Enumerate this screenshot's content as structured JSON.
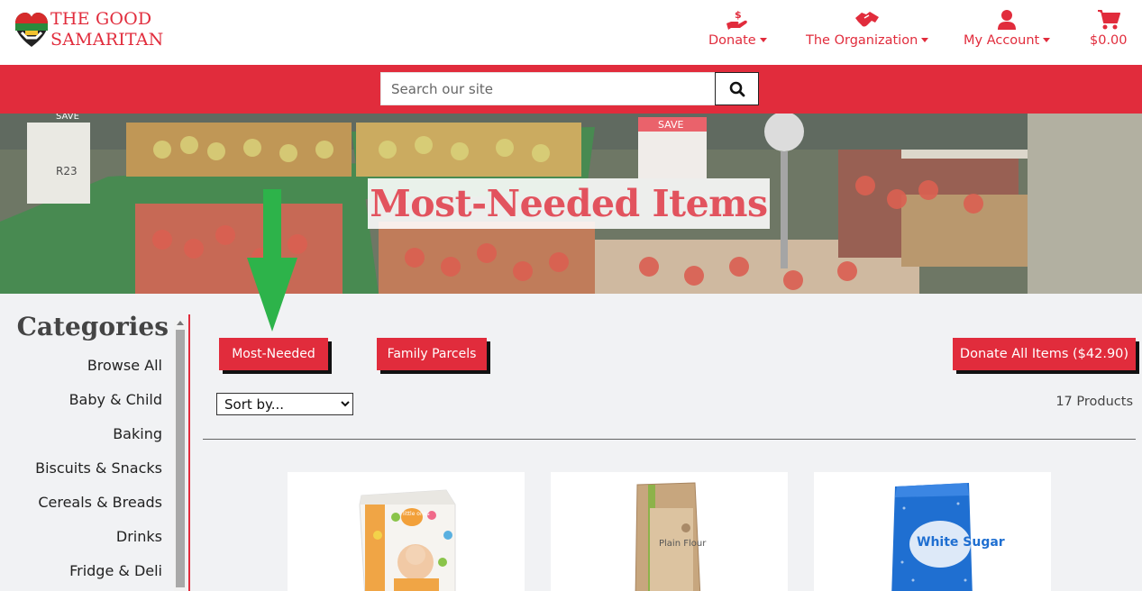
{
  "brand": {
    "line1": "THE GOOD",
    "line2": "SAMARITAN"
  },
  "nav": {
    "donate": "Donate",
    "organization": "The Organization",
    "account": "My Account",
    "cart": "$0.00"
  },
  "search": {
    "placeholder": "Search our site"
  },
  "hero": {
    "title": "Most-Needed Items"
  },
  "sidebar": {
    "title": "Categories",
    "items": [
      "Browse All",
      "Baby & Child",
      "Baking",
      "Biscuits & Snacks",
      "Cereals & Breads",
      "Drinks",
      "Fridge & Deli"
    ]
  },
  "main": {
    "most_needed": "Most-Needed",
    "family_parcels": "Family Parcels",
    "donate_all": "Donate All Items ($42.90)",
    "sort_label": "Sort by...",
    "count": "17 Products"
  },
  "products": [
    {
      "pack_text": "little ones"
    },
    {
      "pack_text": "Plain Flour"
    },
    {
      "pack_text": "White Sugar"
    }
  ],
  "colors": {
    "brand_red": "#e12c3c",
    "title_pink": "#e2535e",
    "annotation_green": "#2db34a"
  }
}
